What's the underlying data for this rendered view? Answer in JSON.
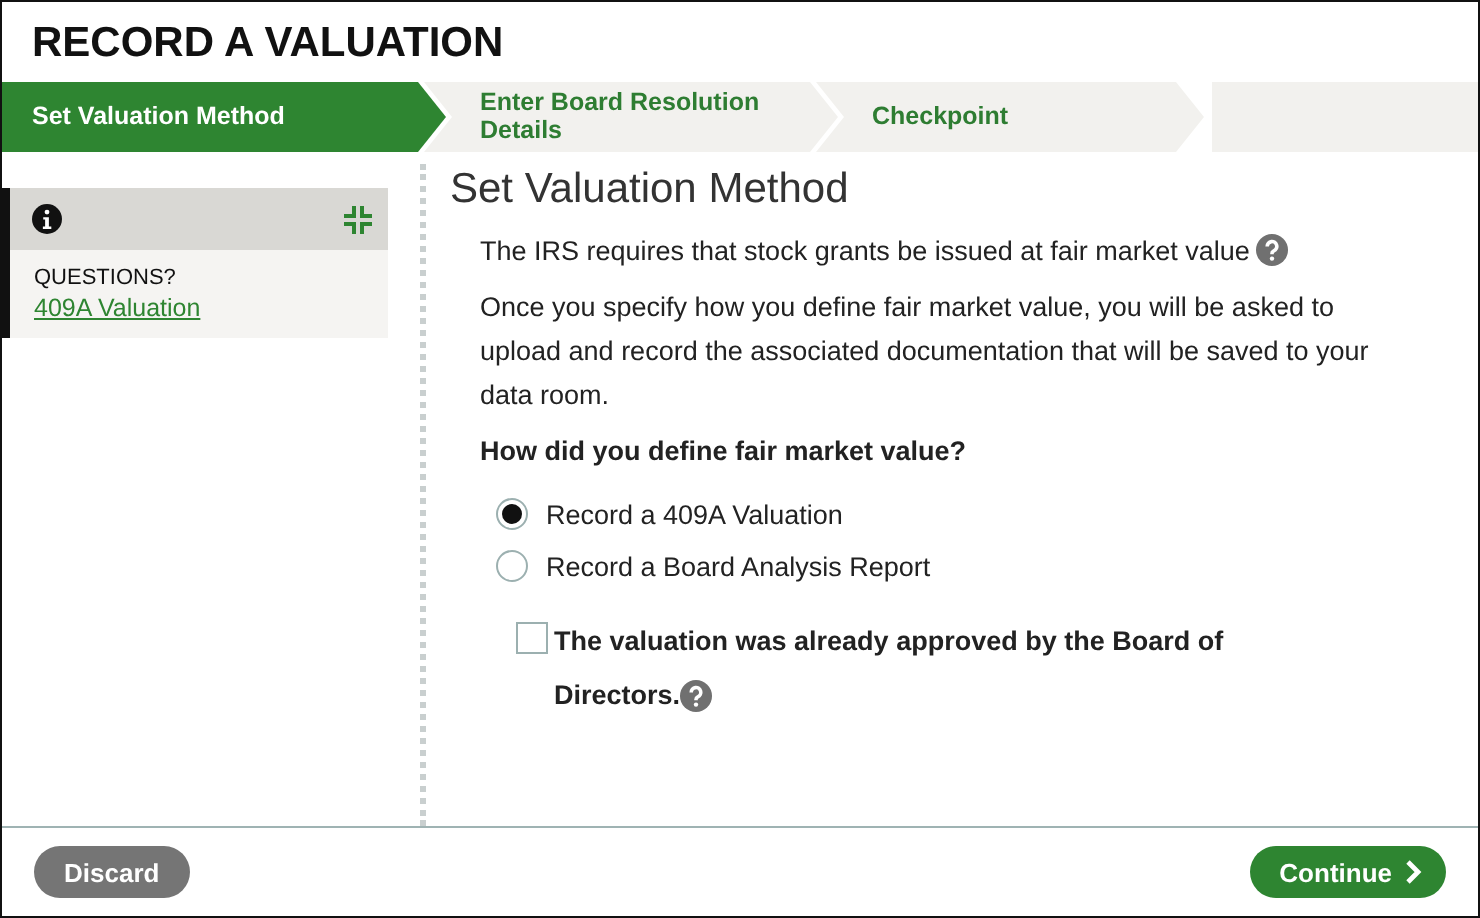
{
  "title": "RECORD A VALUATION",
  "steps": [
    {
      "label": "Set Valuation Method",
      "selected": true
    },
    {
      "label": "Enter Board Resolution Details",
      "selected": false
    },
    {
      "label": "Checkpoint",
      "selected": false
    }
  ],
  "sidebar": {
    "questions_label": "QUESTIONS?",
    "link": "409A Valuation"
  },
  "content": {
    "heading": "Set Valuation Method",
    "intro": "The IRS requires that stock grants be issued at fair market value",
    "paragraph": "Once you specify how you define fair market value, you will be asked to upload and record the associated documentation that will be saved to your data room.",
    "question": "How did you define fair market value?",
    "options": [
      {
        "label": "Record a 409A Valuation",
        "selected": true
      },
      {
        "label": "Record a Board Analysis Report",
        "selected": false
      }
    ],
    "checkbox": {
      "label": "The valuation was already approved by the Board of Directors.",
      "checked": false
    }
  },
  "buttons": {
    "discard": "Discard",
    "continue": "Continue"
  }
}
